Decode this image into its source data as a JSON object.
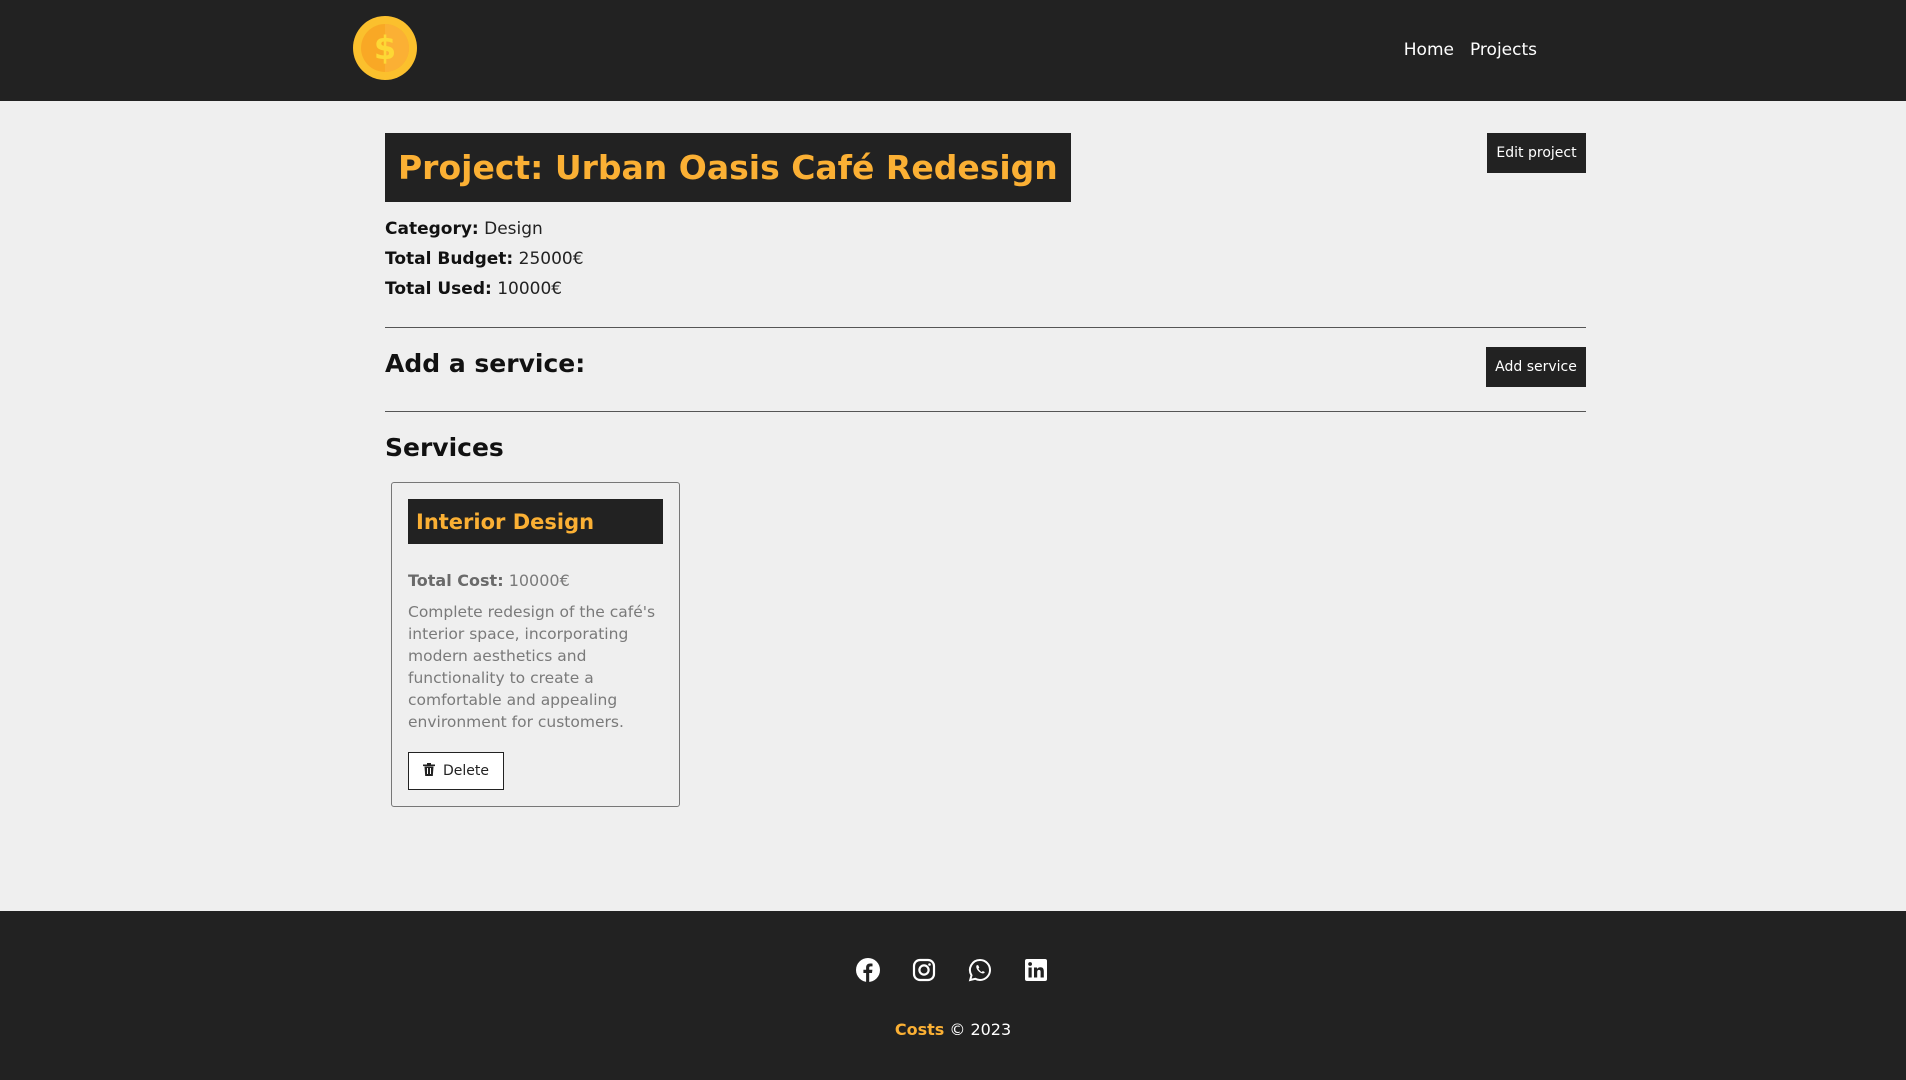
{
  "nav": {
    "links": [
      "Home",
      "Projects"
    ],
    "logo_icon": "dollar-coin-icon"
  },
  "project": {
    "title": "Project: Urban Oasis Café Redesign",
    "edit_label": "Edit project",
    "category_label": "Category:",
    "category": "Design",
    "budget_label": "Total Budget:",
    "budget": "25000€",
    "used_label": "Total Used:",
    "used": "10000€"
  },
  "add_service": {
    "heading": "Add a service:",
    "button_label": "Add service"
  },
  "services": {
    "heading": "Services",
    "items": [
      {
        "name": "Interior Design",
        "cost_label": "Total Cost:",
        "cost": "10000€",
        "description": "Complete redesign of the café's interior space, incorporating modern aesthetics and functionality to create a comfortable and appealing environment for customers.",
        "delete_label": "Delete"
      }
    ]
  },
  "footer": {
    "social_icons": [
      "facebook-icon",
      "instagram-icon",
      "whatsapp-icon",
      "linkedin-icon"
    ],
    "brand": "Costs",
    "copyright": "© 2023"
  },
  "colors": {
    "dark": "#222222",
    "accent": "#fbb034",
    "background": "#efefef"
  }
}
